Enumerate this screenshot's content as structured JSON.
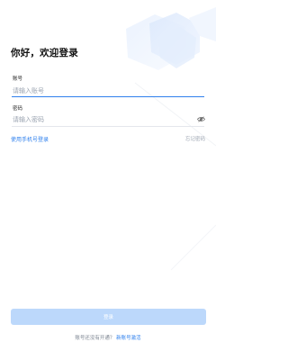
{
  "title": "你好，欢迎登录",
  "account": {
    "label": "账号",
    "placeholder": "请输入账号",
    "value": ""
  },
  "password": {
    "label": "密码",
    "placeholder": "请输入密码",
    "value": ""
  },
  "links": {
    "phone_login": "使用手机号登录",
    "forgot_password": "忘记密码"
  },
  "login_button": {
    "label": "登录"
  },
  "footer": {
    "question": "账号还没有开通？",
    "activate": "新账号激活"
  },
  "colors": {
    "accent": "#2f80ed",
    "button_disabled": "#bcd8fb",
    "placeholder": "#9aa3b0"
  }
}
